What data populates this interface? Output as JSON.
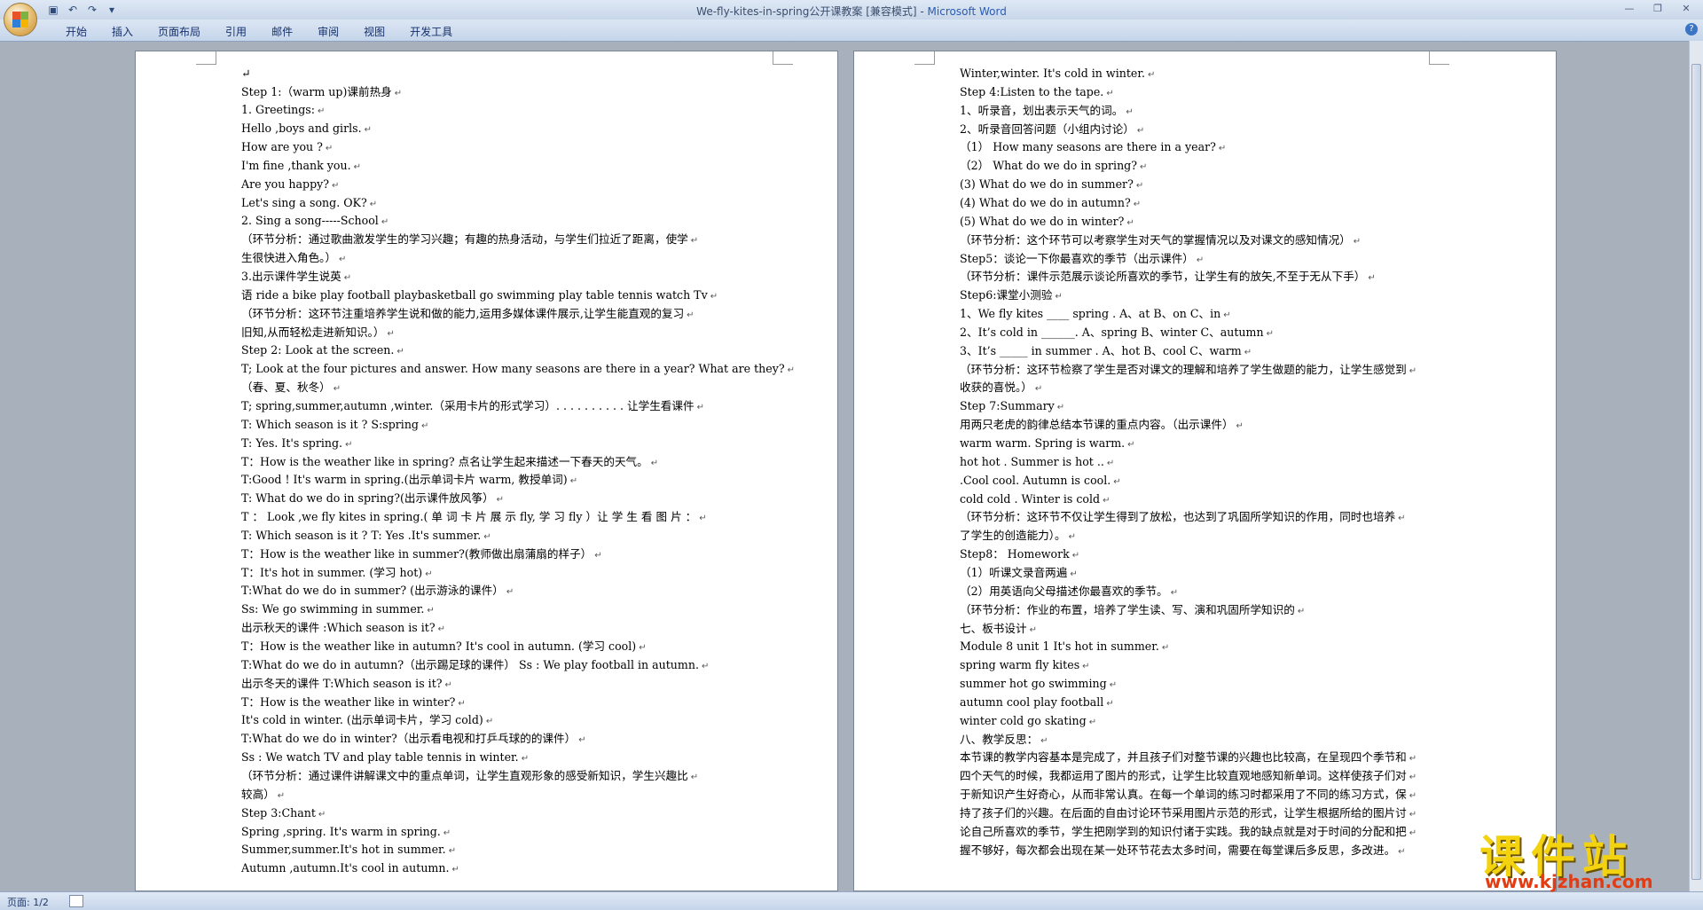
{
  "window": {
    "title_doc": "We-fly-kites-in-spring公开课教案 [兼容模式] - ",
    "title_app": "Microsoft Word"
  },
  "ribbon": {
    "tabs": [
      "开始",
      "插入",
      "页面布局",
      "引用",
      "邮件",
      "审阅",
      "视图",
      "开发工具"
    ]
  },
  "status": {
    "page": "页面: 1/2"
  },
  "watermark": {
    "text": "课件站",
    "url": "www.kjzhan.com"
  },
  "page1": [
    "Step 1:（warm up)课前热身",
    "1. Greetings:",
    " Hello ,boys and girls.",
    "How are you ?",
    " I'm fine ,thank you.",
    "Are you happy?",
    " Let's sing a song. OK?",
    "2. Sing a song-----School",
    "（环节分析：通过歌曲激发学生的学习兴趣；有趣的热身活动，与学生们拉近了距离，使学",
    "生很快进入角色。）",
    "3.出示课件学生说英",
    "语 ride a bike   play football  playbasketball   go swimming  play table tennis  watch Tv",
    "（环节分析：这环节注重培养学生说和做的能力,运用多媒体课件展示,让学生能直观的复习",
    "旧知,从而轻松走进新知识。）",
    " Step 2: Look at the screen.",
    "T; Look at the four pictures and answer. How many seasons are there in a year? What are they?",
    "（春、夏、秋冬）",
    "T; spring,summer,autumn ,winter.（采用卡片的形式学习）. . . . . . . . . .   让学生看课件",
    "T: Which season is it ? S:spring",
    "T: Yes. It's spring.",
    "T：How is the weather like in spring? 点名让学生起来描述一下春天的天气。",
    "T:Good ! It's warm in spring.(出示单词卡片 warm, 教授单词)",
    " T: What do we do in spring?(出示课件放风筝）",
    "T ：  Look ,we fly kites in spring.( 单 词 卡 片 展 示  fly, 学 习  fly ）让 学 生 看 图 片 ：",
    "T: Which season is it ? T: Yes .It's summer.",
    "T：How is the weather like in summer?(教师做出扇蒲扇的样子）",
    "T：It's hot in summer. (学习 hot)",
    "T:What do we do in summer? (出示游泳的课件）",
    "Ss: We go swimming in summer.",
    "出示秋天的课件 :Which season is it?",
    "T：How is the weather like in autumn? It's cool in autumn. (学习 cool)",
    "T:What do we do in autumn?（出示踢足球的课件） Ss : We play football in autumn.",
    "出示冬天的课件 T:Which season is it?",
    "T：How is the weather like in winter?",
    "It's cold in winter. (出示单词卡片，学习 cold)",
    "T:What do we do in winter?（出示看电视和打乒乓球的的课件）",
    " Ss : We watch TV and play table tennis in winter.",
    "（环节分析：通过课件讲解课文中的重点单词，让学生直观形象的感受新知识，学生兴趣比",
    "较高）",
    " Step 3:Chant",
    "Spring ,spring. It's warm in spring.",
    "Summer,summer.It's hot in summer.",
    "Autumn ,autumn.It's cool in autumn."
  ],
  "page2": [
    " Winter,winter. It's cold in winter.",
    " Step 4:Listen to the tape.",
    "1、听录音，划出表示天气的词。",
    "2、听录音回答问题（小组内讨论）",
    "（1）   How many seasons  are there in a year?",
    "（2）    What do we do in spring?",
    " (3)  What do we do in summer?",
    " (4)    What do we do in autumn?",
    " (5)    What do we do in winter?",
    "（环节分析：这个环节可以考察学生对天气的掌握情况以及对课文的感知情况）",
    "Step5：谈论一下你最喜欢的季节（出示课件）",
    "（环节分析：课件示范展示谈论所喜欢的季节，让学生有的放矢,不至于无从下手）",
    "Step6:课堂小测验",
    "1、We fly kites ____ spring .  A、at B、on C、in",
    "2、It’s cold in ______.  A、spring B、winter C、autumn",
    "3、It’s _____ in summer .  A、hot B、cool C、warm",
    "（环节分析：这环节检察了学生是否对课文的理解和培养了学生做题的能力，让学生感觉到",
    "收获的喜悦。）",
    " Step 7:Summary",
    "用两只老虎的韵律总结本节课的重点内容。（出示课件）",
    " warm warm. Spring is warm.",
    " hot hot . Summer is hot ..",
    " .Cool cool.   Autumn is cool.",
    "cold cold . Winter is cold",
    "（环节分析：这环节不仅让学生得到了放松，也达到了巩固所学知识的作用，同时也培养",
    "了学生的创造能力）。",
    " Step8：  Homework",
    "（1）听课文录音两遍",
    "（2）用英语向父母描述你最喜欢的季节。",
    "（环节分析：作业的布置，培养了学生读、写、演和巩固所学知识的",
    "七、板书设计",
    "Module 8 unit 1  It's  hot  in  summer.",
    "spring        warm      fly kites",
    "summer       hot        go swimming",
    "autumn       cool       play football",
    " winter         cold     go skating",
    "八、教学反思：",
    "本节课的教学内容基本是完成了，并且孩子们对整节课的兴趣也比较高，在呈现四个季节和",
    "四个天气的时候，我都运用了图片的形式，让学生比较直观地感知新单词。这样使孩子们对",
    "于新知识产生好奇心，从而非常认真。在每一个单词的练习时都采用了不同的练习方式，保",
    "持了孩子们的兴趣。在后面的自由讨论环节采用图片示范的形式，让学生根据所给的图片讨",
    "论自己所喜欢的季节，学生把刚学到的知识付诸于实践。我的缺点就是对于时间的分配和把",
    "握不够好，每次都会出现在某一处环节花去太多时间，需要在每堂课后多反思，多改进。"
  ]
}
